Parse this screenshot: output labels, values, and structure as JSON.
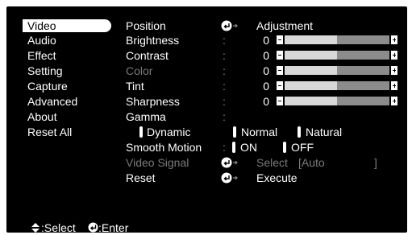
{
  "menu": {
    "items": [
      {
        "label": "Video",
        "selected": true
      },
      {
        "label": "Audio"
      },
      {
        "label": "Effect"
      },
      {
        "label": "Setting"
      },
      {
        "label": "Capture"
      },
      {
        "label": "Advanced"
      },
      {
        "label": "About"
      },
      {
        "label": "Reset All"
      }
    ]
  },
  "video": {
    "position": {
      "label": "Position",
      "action": "Adjustment"
    },
    "brightness": {
      "label": "Brightness",
      "value": "0",
      "level": 0.5
    },
    "contrast": {
      "label": "Contrast",
      "value": "0",
      "level": 0.5
    },
    "color": {
      "label": "Color",
      "value": "0",
      "level": 0.5,
      "disabled": true
    },
    "tint": {
      "label": "Tint",
      "value": "0",
      "level": 0.5
    },
    "sharpness": {
      "label": "Sharpness",
      "value": "0",
      "level": 0.5
    },
    "gamma": {
      "label": "Gamma",
      "options": [
        "Dynamic",
        "Normal",
        "Natural"
      ]
    },
    "smooth_motion": {
      "label": "Smooth Motion",
      "options": [
        "ON",
        "OFF"
      ]
    },
    "video_signal": {
      "label": "Video Signal",
      "action": "Select",
      "value": "[Auto",
      "close": "]",
      "disabled": true
    },
    "reset": {
      "label": "Reset",
      "action": "Execute"
    },
    "colon": ":"
  },
  "footer": {
    "select_hint": ":Select",
    "enter_hint": ":Enter"
  },
  "colors": {
    "background": "#000000",
    "text": "#ffffff",
    "disabled": "#7a7a7a",
    "slider_track": "#8c8c8c",
    "slider_fill": "#d8d8d8"
  }
}
